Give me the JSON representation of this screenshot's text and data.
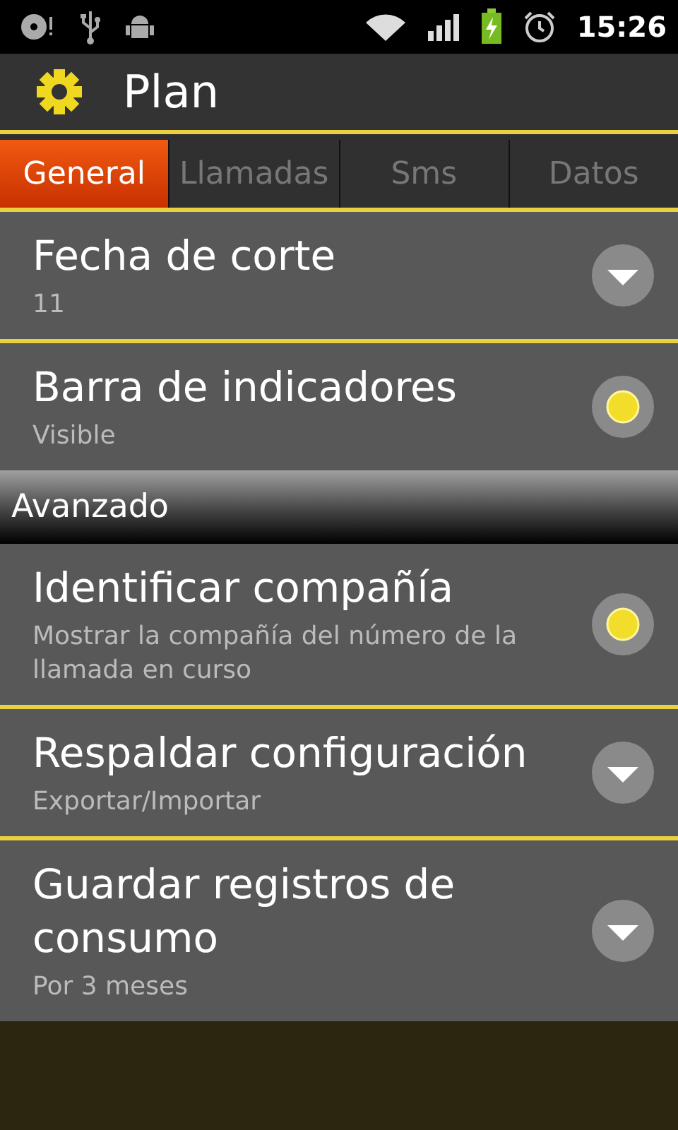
{
  "status_bar": {
    "time": "15:26"
  },
  "header": {
    "title": "Plan"
  },
  "tabs": [
    {
      "label": "General",
      "selected": true
    },
    {
      "label": "Llamadas",
      "selected": false
    },
    {
      "label": "Sms",
      "selected": false
    },
    {
      "label": "Datos",
      "selected": false
    }
  ],
  "groups": [
    {
      "items": [
        {
          "kind": "dropdown",
          "title": "Fecha de corte",
          "summary": "11"
        },
        {
          "kind": "toggle",
          "title": "Barra de indicadores",
          "summary": "Visible",
          "on": true
        }
      ]
    },
    {
      "header": "Avanzado",
      "items": [
        {
          "kind": "toggle",
          "title": "Identificar compañía",
          "summary": "Mostrar la compañía del número de la llamada en curso",
          "on": true
        },
        {
          "kind": "dropdown",
          "title": "Respaldar configuración",
          "summary": "Exportar/Importar"
        },
        {
          "kind": "dropdown",
          "title": "Guardar registros de consumo",
          "summary": "Por 3 meses"
        }
      ]
    }
  ]
}
